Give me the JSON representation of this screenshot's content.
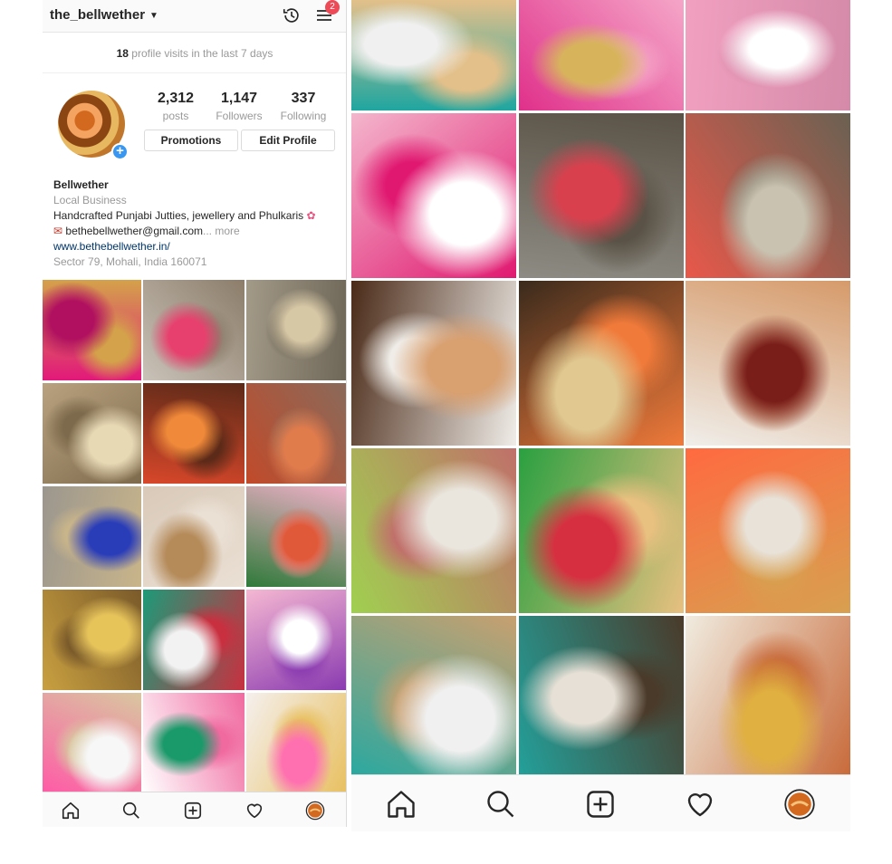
{
  "profile": {
    "username": "the_bellwether",
    "notification_count": "2",
    "visits_count": "18",
    "visits_text": " profile visits in the last 7 days",
    "stats": [
      {
        "count": "2,312",
        "label": "posts"
      },
      {
        "count": "1,147",
        "label": "Followers"
      },
      {
        "count": "337",
        "label": "Following"
      }
    ],
    "buttons": {
      "promotions": "Promotions",
      "edit_profile": "Edit Profile"
    },
    "bio": {
      "name": "Bellwether",
      "category": "Local Business",
      "description": "Handcrafted Punjabi Jutties, jewellery and Phulkaris",
      "email": "bethebellwether@gmail.com",
      "more": "... more",
      "website": "www.bethebellwether.in/",
      "address": "Sector 79, Mohali, India 160071"
    }
  },
  "grid_left_tiles": [
    {
      "colors": [
        "#e2187a",
        "#b0105f",
        "#d4a24a"
      ]
    },
    {
      "colors": [
        "#c9c2b8",
        "#e8406e",
        "#8c7d6a"
      ]
    },
    {
      "colors": [
        "#a39a88",
        "#d6c7a5",
        "#6e6657"
      ]
    },
    {
      "colors": [
        "#b9a27f",
        "#e8d9b5",
        "#7d6a4c"
      ]
    },
    {
      "colors": [
        "#d8472a",
        "#f08a3a",
        "#5c2a18"
      ]
    },
    {
      "colors": [
        "#c14a2a",
        "#e07b4c",
        "#8a6a5a"
      ]
    },
    {
      "colors": [
        "#9b968e",
        "#2a3db8",
        "#c9b58a"
      ]
    },
    {
      "colors": [
        "#d9c9b8",
        "#b58b5a",
        "#eae0d4"
      ]
    },
    {
      "colors": [
        "#2f7a3a",
        "#e05a3a",
        "#f0b0c8"
      ]
    },
    {
      "colors": [
        "#c9a040",
        "#e7c45a",
        "#7a5a2a"
      ]
    },
    {
      "colors": [
        "#1d9a78",
        "#f2f2f2",
        "#c83040"
      ]
    },
    {
      "colors": [
        "#f5b8d2",
        "#ffffff",
        "#8a3ab0"
      ]
    },
    {
      "colors": [
        "#ff5aa6",
        "#f7f7f7",
        "#d9c7a0"
      ]
    },
    {
      "colors": [
        "#ffffff",
        "#1a9a6a",
        "#f06aa0"
      ]
    },
    {
      "colors": [
        "#f5f0ee",
        "#ff70b0",
        "#e8c060"
      ]
    }
  ],
  "grid_right_tiles": [
    {
      "colors": [
        "#1fa6a0",
        "#f0f0f0",
        "#e3c08a"
      ]
    },
    {
      "colors": [
        "#e0308a",
        "#d7b45c",
        "#f5a6c8"
      ]
    },
    {
      "colors": [
        "#f2a0c0",
        "#ffffff",
        "#d48aa8"
      ]
    },
    {
      "colors": [
        "#f4b6cc",
        "#ffffff",
        "#e01870"
      ]
    },
    {
      "colors": [
        "#8d8b83",
        "#d9404e",
        "#5a5246"
      ]
    },
    {
      "colors": [
        "#e8584a",
        "#c9c2b0",
        "#6a6152"
      ]
    },
    {
      "colors": [
        "#4a2a18",
        "#d9a070",
        "#f0ede8"
      ]
    },
    {
      "colors": [
        "#3a2a1c",
        "#e0c890",
        "#f07a3a"
      ]
    },
    {
      "colors": [
        "#f0eeea",
        "#7a1e1a",
        "#d69a6a"
      ]
    },
    {
      "colors": [
        "#a0d050",
        "#eae6de",
        "#c0706a"
      ]
    },
    {
      "colors": [
        "#2aa040",
        "#d63040",
        "#e8c080"
      ]
    },
    {
      "colors": [
        "#ff6a40",
        "#e8e2d8",
        "#d8a050"
      ]
    },
    {
      "colors": [
        "#2aa8a0",
        "#f0f0f0",
        "#c8a070"
      ]
    },
    {
      "colors": [
        "#23a09a",
        "#e6e0d6",
        "#4a3a2a"
      ]
    },
    {
      "colors": [
        "#f0ece0",
        "#e0b040",
        "#c86a3a"
      ]
    }
  ]
}
